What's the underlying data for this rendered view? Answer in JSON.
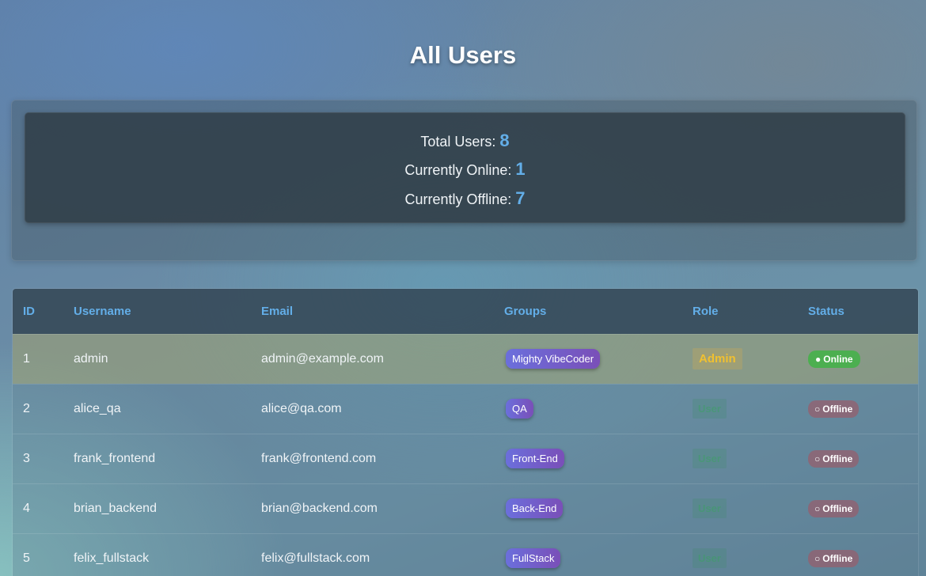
{
  "page": {
    "title": "All Users"
  },
  "stats": {
    "total_label": "Total Users: ",
    "total_value": "8",
    "online_label": "Currently Online: ",
    "online_value": "1",
    "offline_label": "Currently Offline: ",
    "offline_value": "7"
  },
  "table": {
    "headers": {
      "id": "ID",
      "username": "Username",
      "email": "Email",
      "groups": "Groups",
      "role": "Role",
      "status": "Status"
    },
    "rows": [
      {
        "id": "1",
        "username": "admin",
        "email": "admin@example.com",
        "group": "Mighty VibeCoder",
        "role": "Admin",
        "status": "Online",
        "status_icon": "●"
      },
      {
        "id": "2",
        "username": "alice_qa",
        "email": "alice@qa.com",
        "group": "QA",
        "role": "User",
        "status": "Offline",
        "status_icon": "○"
      },
      {
        "id": "3",
        "username": "frank_frontend",
        "email": "frank@frontend.com",
        "group": "Front-End",
        "role": "User",
        "status": "Offline",
        "status_icon": "○"
      },
      {
        "id": "4",
        "username": "brian_backend",
        "email": "brian@backend.com",
        "group": "Back-End",
        "role": "User",
        "status": "Offline",
        "status_icon": "○"
      },
      {
        "id": "5",
        "username": "felix_fullstack",
        "email": "felix@fullstack.com",
        "group": "FullStack",
        "role": "User",
        "status": "Offline",
        "status_icon": "○"
      }
    ]
  },
  "colors": {
    "accent": "#63aee8",
    "online": "#4caf50",
    "admin": "#f0c030",
    "group_gradient_start": "#6b6fdc",
    "group_gradient_end": "#7a4fb8"
  }
}
